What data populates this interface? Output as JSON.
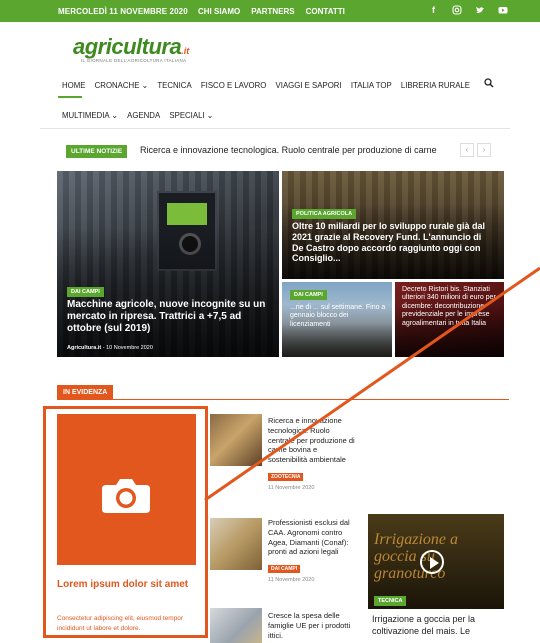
{
  "topbar": {
    "date": "MERCOLEDÌ 11 NOVEMBRE 2020",
    "links": [
      "CHI SIAMO",
      "PARTNERS",
      "CONTATTI"
    ],
    "social": [
      "facebook-icon",
      "instagram-icon",
      "twitter-icon",
      "youtube-icon"
    ]
  },
  "logo": {
    "main": "agricultura",
    "suffix": ".it",
    "tagline": "IL GIORNALE DELL'AGRICOLTURA ITALIANA"
  },
  "nav": {
    "row1": [
      "HOME",
      "CRONACHE ⌄",
      "TECNICA",
      "FISCO E LAVORO",
      "VIAGGI E SAPORI",
      "ITALIA TOP",
      "LIBRERIA RURALE"
    ],
    "row2": [
      "MULTIMEDIA ⌄",
      "AGENDA",
      "SPECIALI ⌄"
    ]
  },
  "ticker": {
    "label": "ULTIME NOTIZIE",
    "text": "Ricerca e innovazione tecnologica. Ruolo centrale per produzione di carne",
    "prev": "‹",
    "next": "›"
  },
  "hero": {
    "main": {
      "category": "DAI CAMPI",
      "title": "Macchine agricole, nuove incognite su un mercato in ripresa. Trattrici a +7,5 ad ottobre (sul 2019)",
      "author": "Agricultura.it",
      "date": "- 10 Novembre 2020"
    },
    "top_right": {
      "category": "POLITICA AGRICOLA",
      "title": "Oltre 10 miliardi per lo sviluppo rurale già dal 2021 grazie al Recovery Fund. L'annuncio di De Castro dopo accordo raggiunto oggi con Consiglio..."
    },
    "bottom_left": {
      "category": "DAI CAMPI",
      "title": "...rie di ... sul settimane. Fino a gennaio blocco dei licenziamenti"
    },
    "bottom_right": {
      "title": "Decreto Ristori bis. Stanziati ulteriori 340 milioni di euro per dicembre: decontribuzione previdenziale per le imprese agroalimentari in tutta Italia"
    }
  },
  "evidenza": {
    "label": "IN EVIDENZA",
    "placeholder": {
      "title": "Lorem ipsum dolor sit amet",
      "text": "Consectetur adipiscing elit, eiusmod tempor incididunt ut labore et dolore."
    },
    "articles": [
      {
        "title": "Ricerca e innovazione tecnologica. Ruolo centrale per produzione di carne bovina e sostenibilità ambientale",
        "category": "ZOOTECNIA",
        "date": "11 Novembre 2020"
      },
      {
        "title": "Professionisti esclusi dal CAA. Agronomi contro Agea, Diamanti (Conaf): pronti ad azioni legali",
        "category": "DAI CAMPI",
        "date": "11 Novembre 2020"
      },
      {
        "title": "Cresce la spesa delle famiglie UE per i prodotti ittici.",
        "category": "",
        "date": ""
      }
    ],
    "video": {
      "overlay_text": "Irrigazione a goccia su granoturco",
      "category": "TECNICA",
      "title": "Irrigazione a goccia per la coltivazione del mais. Le"
    }
  },
  "colors": {
    "brand_green": "#5aa62f",
    "accent_orange": "#e2571e"
  }
}
